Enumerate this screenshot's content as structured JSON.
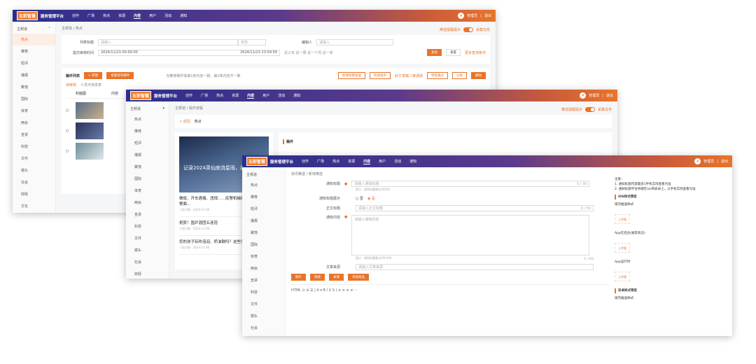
{
  "app": {
    "logo_text": "五彩智慧",
    "title": "服务管理平台",
    "nav": [
      "创作",
      "广场",
      "热点",
      "资源",
      "内容",
      "用户",
      "活动",
      "通知"
    ],
    "nav_active": 4,
    "user_name": "管理员",
    "logout": "退出",
    "avatar_glyph": "A"
  },
  "w1": {
    "breadcrumb": "主频道  /  热点",
    "sidebar_head": "主频道",
    "sidebar_items": [
      "热点",
      "推荐",
      "短评",
      "播报",
      "聚落",
      "国际",
      "体育",
      "两会",
      "宣讲",
      "科技",
      "文件",
      "镜头",
      "社会",
      "财经",
      "文化",
      "教育",
      "军事"
    ],
    "push_label": "推送提醒提示",
    "collect_label": "采集任务",
    "filter": {
      "title_label": "列表标题",
      "title_placeholder": "请输入",
      "status_value": "状态",
      "editor_label": "编辑人",
      "editor_placeholder": "请输入",
      "time_label": "提交审核时间",
      "time_start": "2024/11/23 00:00:00",
      "time_end": "2024/11/23 23:59:59",
      "quick_time": "近三天    近一周    近一个月    近一年",
      "search_btn": "查询",
      "reset_btn": "重置",
      "more_btn": "更多查询条件"
    },
    "list": {
      "title": "稿件列表",
      "btn_add": "+ 新建",
      "btn_batch": "批量发布稿件",
      "hint": "当推荐稿件需第1条内容一致，第2条内容不一致",
      "btn_a": "新建快稿发送",
      "btn_b": "快速发布",
      "btn_c": "处于发稿二审通道",
      "btn_d": "审核通过",
      "btn_e": "分类",
      "btn_f": "删除",
      "tab1": "待审核",
      "tab2": "人员可待发表",
      "col1": "封面图",
      "col2": "内容"
    }
  },
  "w2": {
    "breadcrumb": "主频道  /  操作流程",
    "sidebar_head": "主频道",
    "sidebar_items": [
      "热点",
      "推荐",
      "短评",
      "播报",
      "聚落",
      "国际",
      "体育",
      "两会",
      "宣讲",
      "科技",
      "文件",
      "镜头",
      "社会",
      "财经",
      "文化",
      "教育"
    ],
    "push_label": "推送提醒提示",
    "collect_label": "采集任务",
    "back": "< 返回",
    "crumb_sub": "热点",
    "draft_label": "稿件",
    "news": [
      {
        "title": "记录2024英仙座流星雨，星很壮观！",
        "meta": ""
      },
      {
        "title": "做饭、开车遇堵、违规……民警机械维修避暑人满出警面…",
        "meta": "人民日报 · 2024-11-06"
      },
      {
        "title": "祝贺！国乒混团五连冠",
        "meta": "人民日报 · 2024-11-06"
      },
      {
        "title": "您的孩子玩吹泡泡、奶油鼓吗？这些安全风险要知道",
        "meta": "人民日报 · 2024-11-06"
      }
    ]
  },
  "w3": {
    "breadcrumb": "快讯推送  /  新增推送",
    "sidebar_head": "主频道",
    "sidebar_items": [
      "热点",
      "推荐",
      "短评",
      "播报",
      "聚落",
      "国际",
      "体育",
      "两会",
      "宣讲",
      "科技",
      "文件",
      "镜头",
      "社会",
      "财经",
      "文化"
    ],
    "form": {
      "notice_title_label": "通知标题",
      "notice_title_placeholder": "请输入通知标题",
      "notice_title_hint": "提示：通知标题最长30字符",
      "notice_title_count": "0 / 30",
      "show_label": "通知标题展示",
      "opt_no": "否",
      "opt_yes": "是",
      "body_title_label": "正文标题",
      "body_title_placeholder": "请输入正文标题",
      "body_title_count": "0 / 50",
      "content_label": "通知内容",
      "content_placeholder": "请输入通知内容",
      "content_hint": "提示：通知标题最长200字符",
      "content_count": "0 / 200",
      "article_label": "文章来源",
      "article_placeholder": "请输入文章来源",
      "btn_1": "图片",
      "btn_2": "链接",
      "btn_3": "表情",
      "btn_4": "添加商品",
      "toolbar": "HTML  ⊙  ⊘  ☰  |  A  ▾  B  I  U  S  |  ≡  ≡  ≡  ≡  ···"
    },
    "notes": {
      "title": "注意：",
      "line1": "1. 通知标题内容最多1手机实际查看为准",
      "line2": "2. 通知标题平台终端在ios和安卓上，以手机实际查看为准",
      "ios_title": "iOS样式预览",
      "lock_label": "锁内推送样式",
      "app_bg_label": "App在后台(通常状态)",
      "app_fg_label": "App运行时",
      "android_title": "安卓样式预览",
      "upload_text": "上传图",
      "more_label": "锁内推送样式"
    }
  }
}
